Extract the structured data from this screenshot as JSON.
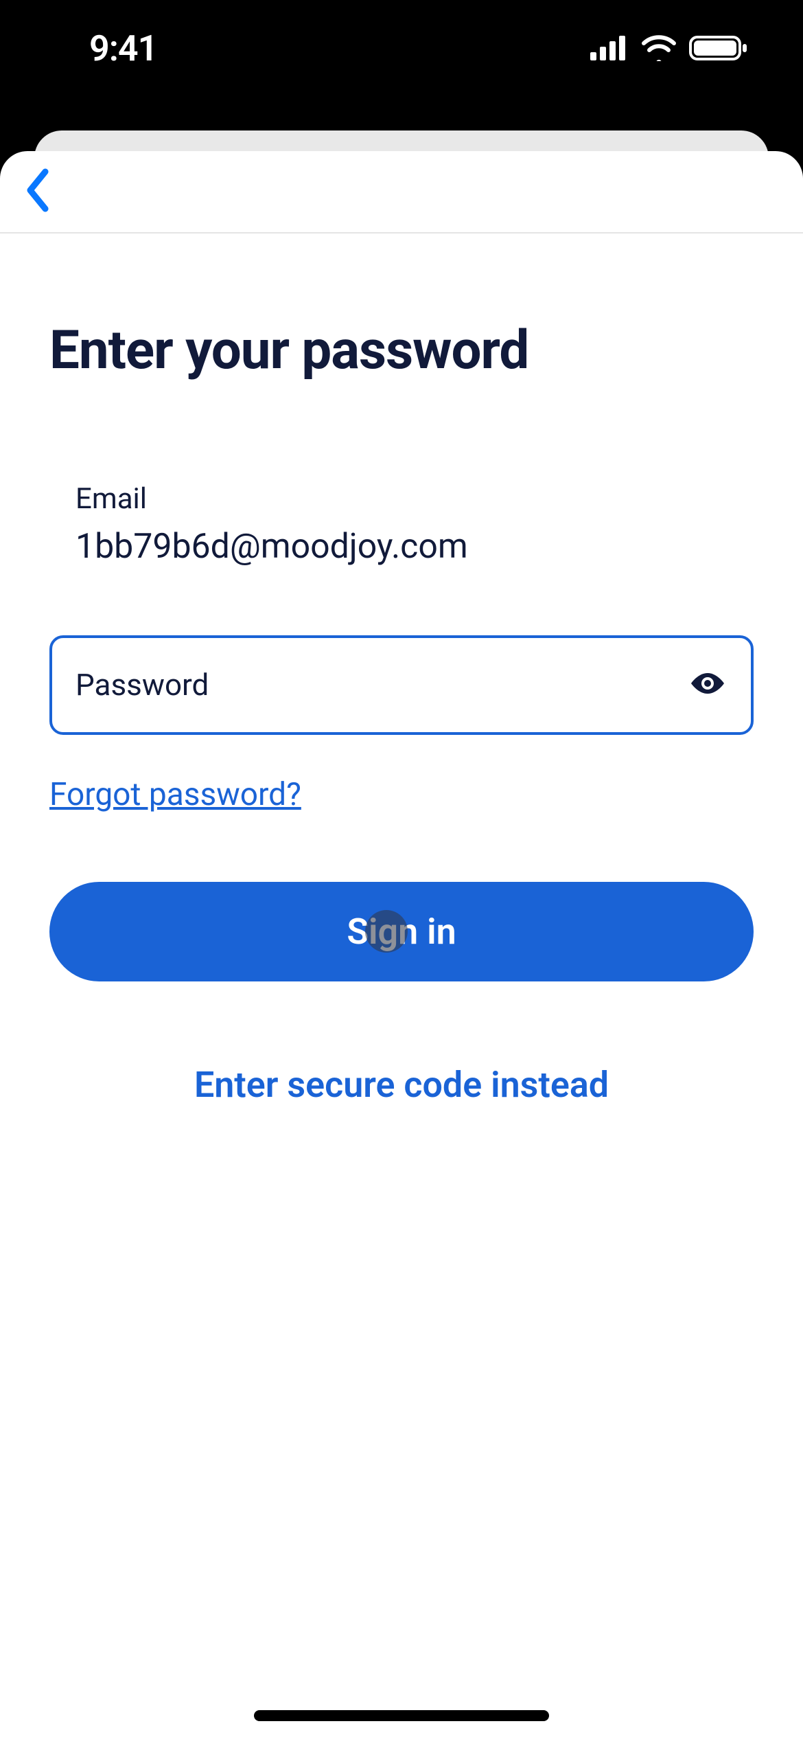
{
  "status": {
    "time": "9:41"
  },
  "page": {
    "title": "Enter your password"
  },
  "email": {
    "label": "Email",
    "value": "1bb79b6d@moodjoy.com"
  },
  "password": {
    "label": "Password",
    "value": ""
  },
  "links": {
    "forgot": "Forgot password?",
    "secure_code": "Enter secure code instead"
  },
  "buttons": {
    "signin": "Sign in"
  },
  "colors": {
    "accent": "#1a63d6",
    "text_dark": "#111a3a"
  }
}
